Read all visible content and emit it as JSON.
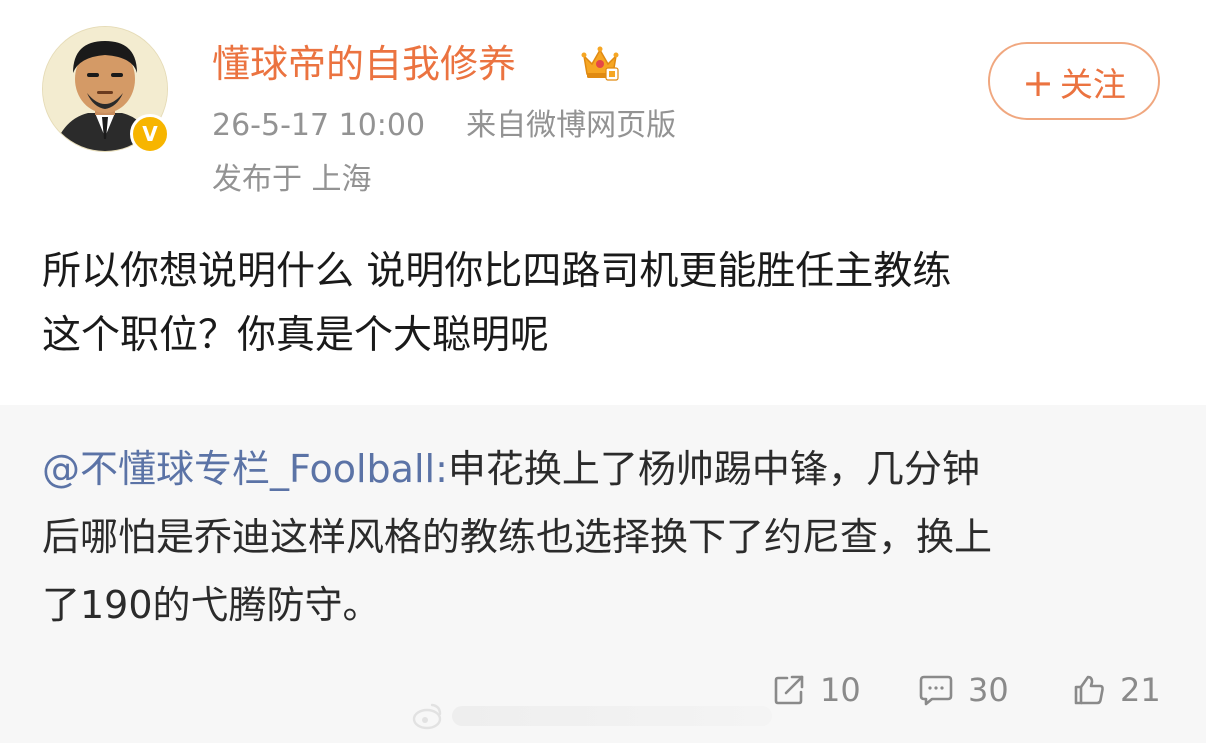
{
  "post": {
    "username": "懂球帝的自我修养",
    "timestamp": "26-5-17 10:00",
    "source": "来自微博网页版",
    "location": "发布于 上海",
    "follow_label": "关注",
    "follow_plus": "+",
    "verified_badge": "V",
    "text_line1": "所以你想说明什么 说明你比四路司机更能胜任主教练",
    "text_line2": "这个职位？你真是个大聪明呢"
  },
  "quote": {
    "mention": "@不懂球专栏_Foolball:",
    "text_line1": "申花换上了杨帅踢中锋，几分钟",
    "text_line2": "后哪怕是乔迪这样风格的教练也选择换下了约尼查，换上",
    "text_line3": "了190的弋腾防守。"
  },
  "actions": {
    "share_count": "10",
    "comment_count": "30",
    "like_count": "21"
  },
  "icons": {
    "crown": "crown-icon",
    "share": "share-icon",
    "comment": "comment-icon",
    "like": "like-icon"
  },
  "colors": {
    "username": "#eb7340",
    "mention": "#5b73a6",
    "meta": "#939393",
    "quote_bg": "#f7f7f7",
    "verified": "#f7b500"
  }
}
